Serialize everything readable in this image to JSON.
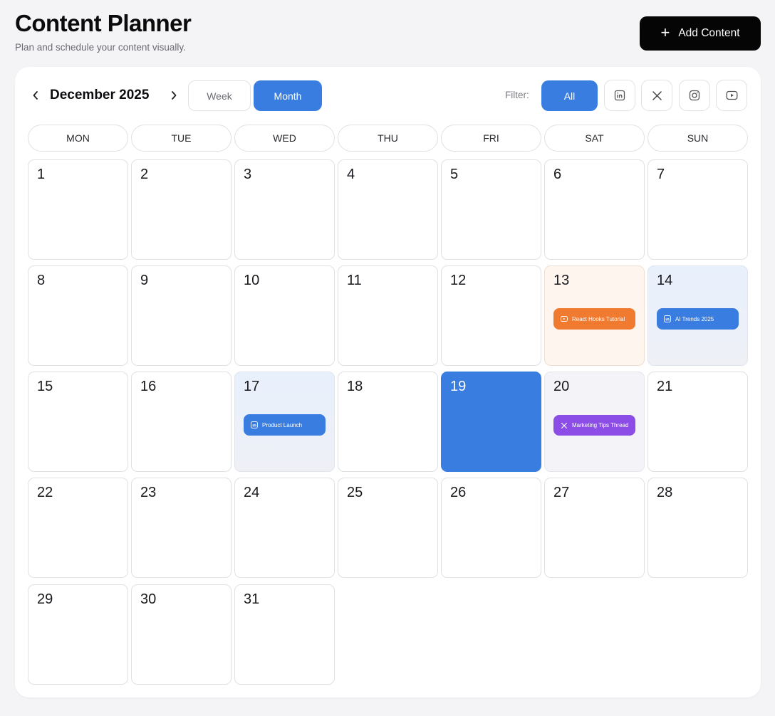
{
  "header": {
    "title": "Content Planner",
    "subtitle": "Plan and schedule your content visually.",
    "add_button": {
      "label": "Add Content",
      "icon": "plus-icon"
    }
  },
  "toolbar": {
    "month_label": "December 2025",
    "prev_icon": "chevron-left-icon",
    "next_icon": "chevron-right-icon",
    "views": [
      {
        "label": "Week",
        "active": false
      },
      {
        "label": "Month",
        "active": true
      }
    ],
    "filter_label": "Filter:",
    "filters": [
      {
        "label": "All",
        "active": true
      },
      {
        "icon": "linkedin-icon"
      },
      {
        "icon": "x-icon"
      },
      {
        "icon": "instagram-icon"
      },
      {
        "icon": "youtube-icon"
      }
    ]
  },
  "calendar": {
    "weekdays": [
      "MON",
      "TUE",
      "WED",
      "THU",
      "FRI",
      "SAT",
      "SUN"
    ],
    "days": [
      "1",
      "2",
      "3",
      "4",
      "5",
      "6",
      "7",
      "8",
      "9",
      "10",
      "11",
      "12",
      "13",
      "14",
      "15",
      "16",
      "17",
      "18",
      "19",
      "20",
      "21",
      "22",
      "23",
      "24",
      "25",
      "26",
      "27",
      "28",
      "29",
      "30",
      "31"
    ],
    "today": "19",
    "events": [
      {
        "day": "13",
        "title": "React Hooks Tutorial",
        "platform": "youtube-icon",
        "color": "#f17a31"
      },
      {
        "day": "14",
        "title": "AI Trends 2025",
        "platform": "linkedin-icon",
        "color": "#3a7de0"
      },
      {
        "day": "17",
        "title": "Product Launch",
        "platform": "linkedin-icon",
        "color": "#3a7de0"
      },
      {
        "day": "20",
        "title": "Marketing Tips Thread",
        "platform": "x-icon",
        "color": "#8c4de7"
      }
    ]
  },
  "colors": {
    "accent": "#3a7de0",
    "youtube_event": "#f17a31",
    "x_event": "#8c4de7",
    "primary_button": "#050505"
  }
}
